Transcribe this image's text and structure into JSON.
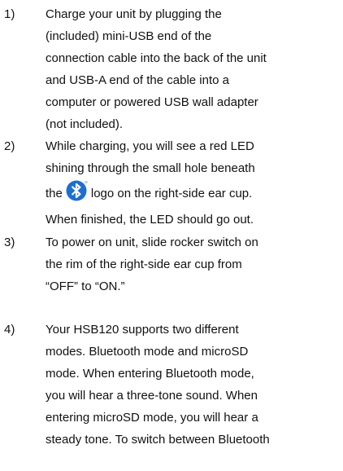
{
  "instructions": [
    {
      "number": "1)",
      "lines": [
        "Charge your unit by plugging the",
        "(included) mini-USB  end of the",
        "connection cable into the back of the unit",
        "and USB-A end of the cable into a",
        "computer or powered USB wall adapter",
        "(not included)."
      ]
    },
    {
      "number": "2)",
      "lines": [
        "While charging, you will see a red LED",
        "shining through the small hole beneath"
      ],
      "logo_line": {
        "before": "the",
        "icon": "bluetooth-logo",
        "after": "logo on the right-side ear cup."
      },
      "after_lines": [
        "When finished, the LED should go out."
      ]
    },
    {
      "number": "3)",
      "lines": [
        "To power on unit, slide rocker switch on",
        "the rim of the right-side ear cup from",
        "“OFF” to “ON.”"
      ]
    },
    {
      "number": "4)",
      "lines": [
        "Your HSB120 supports two different",
        "modes.  Bluetooth mode and microSD",
        "mode. When entering Bluetooth mode,",
        "you will hear a three-tone sound. When",
        "entering microSD mode, you will hear a",
        "steady tone. To switch between Bluetooth"
      ]
    }
  ],
  "colors": {
    "text": "#111111",
    "bluetooth_blue": "#1d6fd0"
  }
}
